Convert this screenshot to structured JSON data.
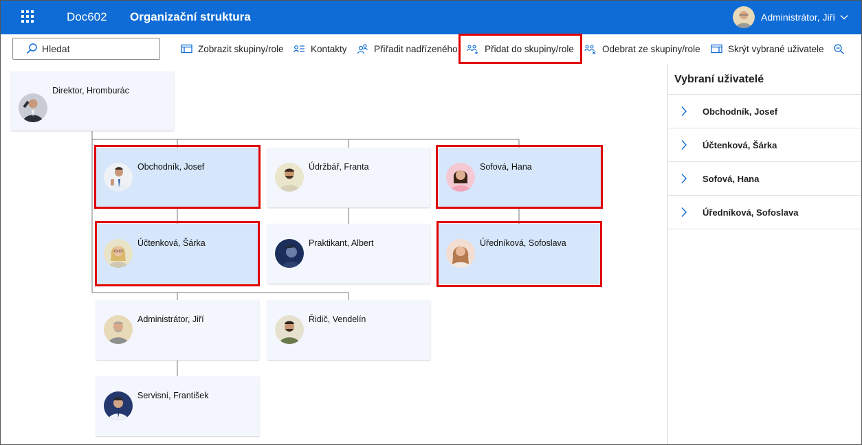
{
  "header": {
    "brand": "Doc602",
    "title": "Organizační struktura",
    "user_name": "Administrátor, Jiří",
    "icons": [
      "app-launcher-icon",
      "chevron-down-icon"
    ]
  },
  "toolbar": {
    "search_placeholder": "Hledat",
    "buttons": {
      "show_groups": "Zobrazit skupiny/role",
      "contacts": "Kontakty",
      "assign_superior": "Přiřadit nadřízeného",
      "add_to_group": "Přidat do skupiny/role",
      "remove_from_group": "Odebrat ze skupiny/role",
      "hide_selected": "Skrýt vybrané uživatele"
    }
  },
  "org": {
    "director": "Direktor, Hromburác",
    "cards": [
      {
        "name": "Obchodník, Josef",
        "selected": true
      },
      {
        "name": "Údržbář, Franta",
        "selected": false
      },
      {
        "name": "Sofová, Hana",
        "selected": true
      },
      {
        "name": "Účtenková, Šárka",
        "selected": true
      },
      {
        "name": "Praktikant, Albert",
        "selected": false
      },
      {
        "name": "Úředníková, Sofoslava",
        "selected": true
      },
      {
        "name": "Administrátor, Jiří",
        "selected": false
      },
      {
        "name": "Řidič, Vendelín",
        "selected": false
      },
      {
        "name": "Servisní, František",
        "selected": false
      }
    ]
  },
  "panel": {
    "title": "Vybraní uživatelé",
    "items": [
      "Obchodník, Josef",
      "Účtenková, Šárka",
      "Sofová, Hana",
      "Úředníková, Sofoslava"
    ]
  },
  "colors": {
    "header_bg": "#0f6cd6",
    "card_bg": "#f3f6fd",
    "card_selected_bg": "#d6e6fb",
    "highlight": "#e00000",
    "icon_blue": "#0f6cd6"
  }
}
